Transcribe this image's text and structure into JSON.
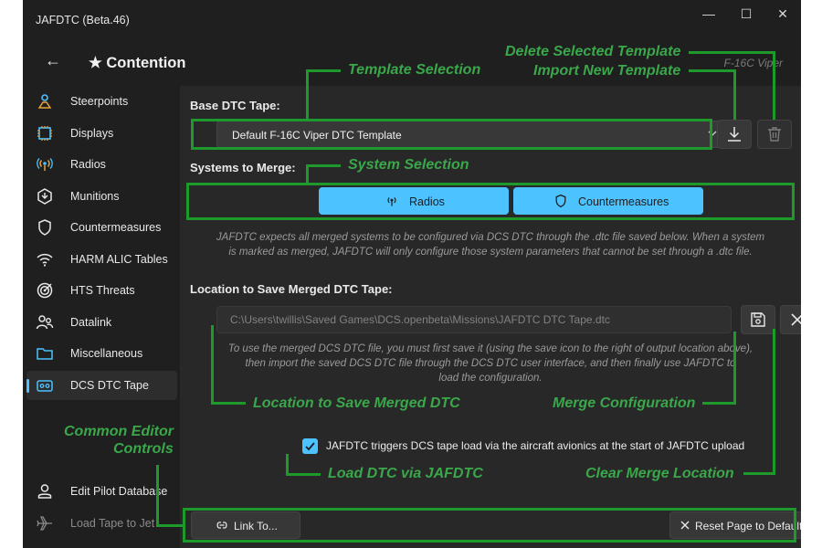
{
  "window": {
    "title": "JAFDTC (Beta.46)",
    "controls": {
      "minimize": "—",
      "maximize": "☐",
      "close": "✕"
    }
  },
  "header": {
    "back": "←",
    "config_name": "★ Contention",
    "airframe": "F-16C Viper"
  },
  "nav": {
    "items": [
      {
        "label": "Steerpoints",
        "icon": "steerpoint-icon"
      },
      {
        "label": "Displays",
        "icon": "displays-chip-icon"
      },
      {
        "label": "Radios",
        "icon": "radio-antenna-icon"
      },
      {
        "label": "Munitions",
        "icon": "munitions-icon"
      },
      {
        "label": "Countermeasures",
        "icon": "shield-icon"
      },
      {
        "label": "HARM ALIC Tables",
        "icon": "wifi-icon"
      },
      {
        "label": "HTS Threats",
        "icon": "target-icon"
      },
      {
        "label": "Datalink",
        "icon": "datalink-people-icon"
      },
      {
        "label": "Miscellaneous",
        "icon": "folder-icon"
      },
      {
        "label": "DCS DTC Tape",
        "icon": "tape-icon",
        "selected": true
      }
    ],
    "bottom_items": [
      {
        "label": "Edit Pilot Database",
        "icon": "person-icon"
      },
      {
        "label": "Load Tape to Jet",
        "icon": "airplane-icon",
        "disabled": true
      }
    ]
  },
  "content": {
    "base_tape_label": "Base DTC Tape:",
    "template_value": "Default F-16C Viper DTC Template",
    "systems_label": "Systems to Merge:",
    "systems": [
      {
        "label": "Radios",
        "icon": "radio-antenna-icon"
      },
      {
        "label": "Countermeasures",
        "icon": "shield-icon"
      }
    ],
    "merge_note_lines": [
      "JAFDTC expects all merged systems to be configured via DCS DTC through the .dtc file saved below. When a system",
      "is marked as merged, JAFDTC will only configure those system parameters that cannot be set through a .dtc file."
    ],
    "location_label": "Location to Save Merged DTC Tape:",
    "location_value": "C:\\Users\\twillis\\Saved Games\\DCS.openbeta\\Missions\\JAFDTC DTC Tape.dtc",
    "save_note_lines": [
      "To use the merged DCS DTC file, you must first save it (using the save icon to the right of output location above),",
      "then import the saved DCS DTC file through the DCS DTC user interface, and then finally use JAFDTC to",
      "load the configuration."
    ],
    "avionics_checkbox_label": "JAFDTC triggers DCS tape load via the aircraft avionics at the start of JAFDTC upload",
    "avionics_checked": true,
    "link_button": "Link To...",
    "reset_button": "Reset Page to Defaults"
  },
  "annotations": {
    "delete_template": "Delete Selected Template",
    "import_template": "Import New Template",
    "template_selection": "Template Selection",
    "system_selection": "System Selection",
    "location": "Location to Save Merged DTC",
    "merge_config": "Merge Configuration",
    "common_line1": "Common Editor",
    "common_line2": "Controls",
    "load_dtc": "Load DTC via JAFDTC",
    "clear_location": "Clear Merge Location"
  },
  "colors": {
    "accent": "#4cc2ff",
    "annotation": "#1e9a2c",
    "annotation_text": "#3aa84a",
    "window_bg": "#1f1f1f",
    "content_bg": "#282828"
  }
}
